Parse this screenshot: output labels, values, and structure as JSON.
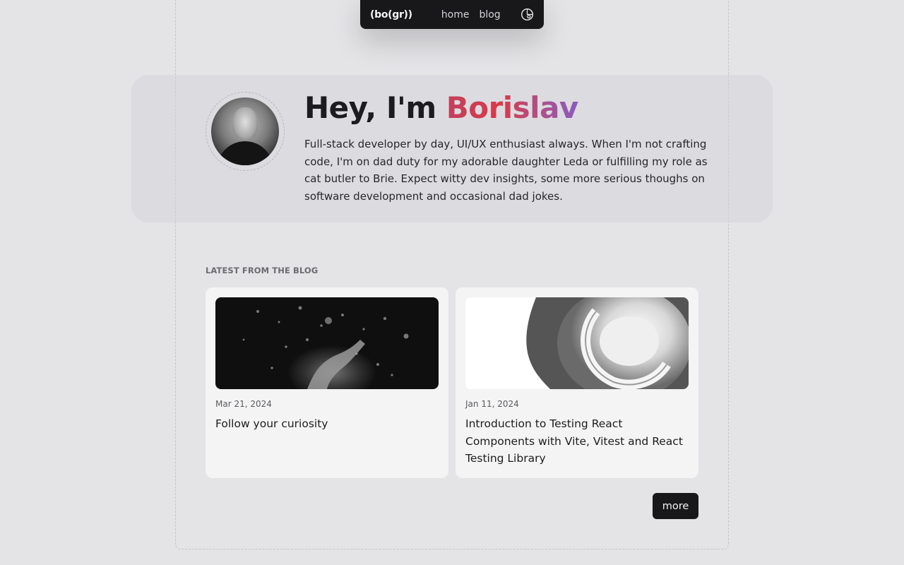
{
  "nav": {
    "logo": "(bo(gr))",
    "links": [
      "home",
      "blog"
    ],
    "theme_icon": "theme-toggle-icon"
  },
  "hero": {
    "greeting": "Hey, I'm ",
    "name": "Borislav",
    "bio": "Full-stack developer by day, UI/UX enthusiast always. When I'm not crafting code, I'm on dad duty for my adorable daughter Leda or fulfilling my role as cat butler to Brie. Expect witty dev insights, some more serious thoughs on software development and occasional dad jokes."
  },
  "blog": {
    "section_label": "LATEST FROM THE BLOG",
    "posts": [
      {
        "date": "Mar 21, 2024",
        "title": "Follow your curiosity"
      },
      {
        "date": "Jan 11, 2024",
        "title": "Introduction to Testing React Components with Vite, Vitest and React Testing Library"
      }
    ],
    "more_label": "more"
  },
  "colors": {
    "background": "#e4e4e7",
    "dark": "#18181b",
    "name_gradient": [
      "#c2415c",
      "#d9394a",
      "#8a5cc0"
    ]
  }
}
